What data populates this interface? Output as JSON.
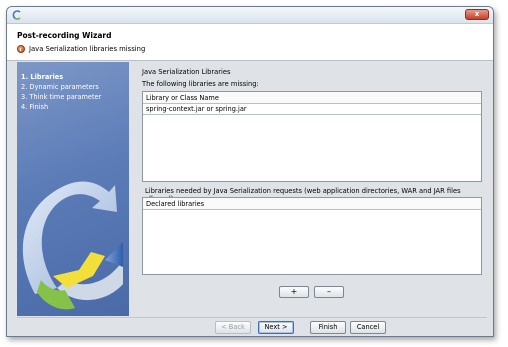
{
  "window": {
    "close_label": "x"
  },
  "header": {
    "title": "Post-recording Wizard",
    "message": "Java Serialization libraries missing"
  },
  "steps": [
    {
      "label": "1. Libraries",
      "active": true
    },
    {
      "label": "2. Dynamic parameters",
      "active": false
    },
    {
      "label": "3. Think time parameter",
      "active": false
    },
    {
      "label": "4. Finish",
      "active": false
    }
  ],
  "main": {
    "section_title": "Java Serialization Libraries",
    "missing_label": "The following libraries are missing:",
    "missing_table": {
      "column": "Library or Class Name",
      "rows": [
        "spring-context.jar or spring.jar"
      ]
    },
    "needed_label": "Libraries needed by Java Serialization requests (web application directories, WAR and JAR files allowed).",
    "declared_table": {
      "column": "Declared libraries",
      "rows": []
    },
    "add_label": "+",
    "remove_label": "–"
  },
  "footer": {
    "back_label": "< Back",
    "next_label": "Next >",
    "finish_label": "Finish",
    "cancel_label": "Cancel"
  }
}
